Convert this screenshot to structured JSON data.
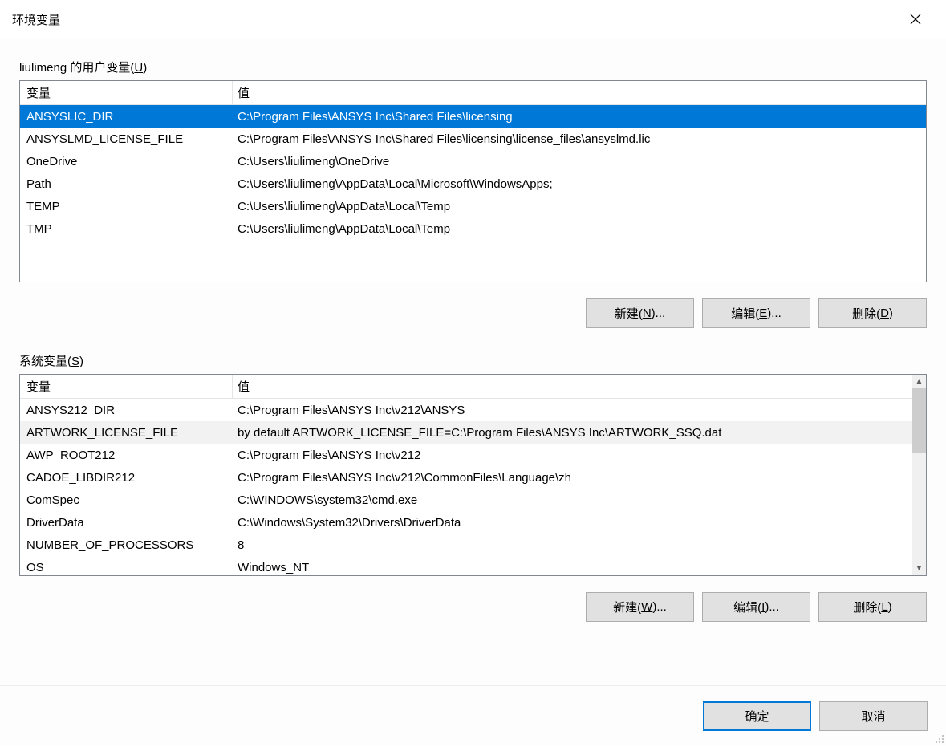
{
  "dialog_title": "环境变量",
  "user_section_label_prefix": "liulimeng 的用户变量(",
  "user_section_label_key": "U",
  "user_section_label_suffix": ")",
  "system_section_label_prefix": "系统变量(",
  "system_section_label_key": "S",
  "system_section_label_suffix": ")",
  "col_variable": "变量",
  "col_value": "值",
  "user_vars": [
    {
      "name": "ANSYSLIC_DIR",
      "value": "C:\\Program Files\\ANSYS Inc\\Shared Files\\licensing",
      "selected": true
    },
    {
      "name": "ANSYSLMD_LICENSE_FILE",
      "value": "C:\\Program Files\\ANSYS Inc\\Shared Files\\licensing\\license_files\\ansyslmd.lic"
    },
    {
      "name": "OneDrive",
      "value": "C:\\Users\\liulimeng\\OneDrive"
    },
    {
      "name": "Path",
      "value": "C:\\Users\\liulimeng\\AppData\\Local\\Microsoft\\WindowsApps;"
    },
    {
      "name": "TEMP",
      "value": "C:\\Users\\liulimeng\\AppData\\Local\\Temp"
    },
    {
      "name": "TMP",
      "value": "C:\\Users\\liulimeng\\AppData\\Local\\Temp"
    }
  ],
  "system_vars": [
    {
      "name": "ANSYS212_DIR",
      "value": "C:\\Program Files\\ANSYS Inc\\v212\\ANSYS"
    },
    {
      "name": "ARTWORK_LICENSE_FILE",
      "value": "by default ARTWORK_LICENSE_FILE=C:\\Program Files\\ANSYS Inc\\ARTWORK_SSQ.dat",
      "hover": true
    },
    {
      "name": "AWP_ROOT212",
      "value": "C:\\Program Files\\ANSYS Inc\\v212"
    },
    {
      "name": "CADOE_LIBDIR212",
      "value": "C:\\Program Files\\ANSYS Inc\\v212\\CommonFiles\\Language\\zh"
    },
    {
      "name": "ComSpec",
      "value": "C:\\WINDOWS\\system32\\cmd.exe"
    },
    {
      "name": "DriverData",
      "value": "C:\\Windows\\System32\\Drivers\\DriverData"
    },
    {
      "name": "NUMBER_OF_PROCESSORS",
      "value": "8"
    },
    {
      "name": "OS",
      "value": "Windows_NT"
    }
  ],
  "buttons": {
    "user_new_prefix": "新建(",
    "user_new_key": "N",
    "user_new_suffix": ")...",
    "user_edit_prefix": "编辑(",
    "user_edit_key": "E",
    "user_edit_suffix": ")...",
    "user_delete_prefix": "删除(",
    "user_delete_key": "D",
    "user_delete_suffix": ")",
    "sys_new_prefix": "新建(",
    "sys_new_key": "W",
    "sys_new_suffix": ")...",
    "sys_edit_prefix": "编辑(",
    "sys_edit_key": "I",
    "sys_edit_suffix": ")...",
    "sys_delete_prefix": "删除(",
    "sys_delete_key": "L",
    "sys_delete_suffix": ")",
    "ok": "确定",
    "cancel": "取消"
  }
}
